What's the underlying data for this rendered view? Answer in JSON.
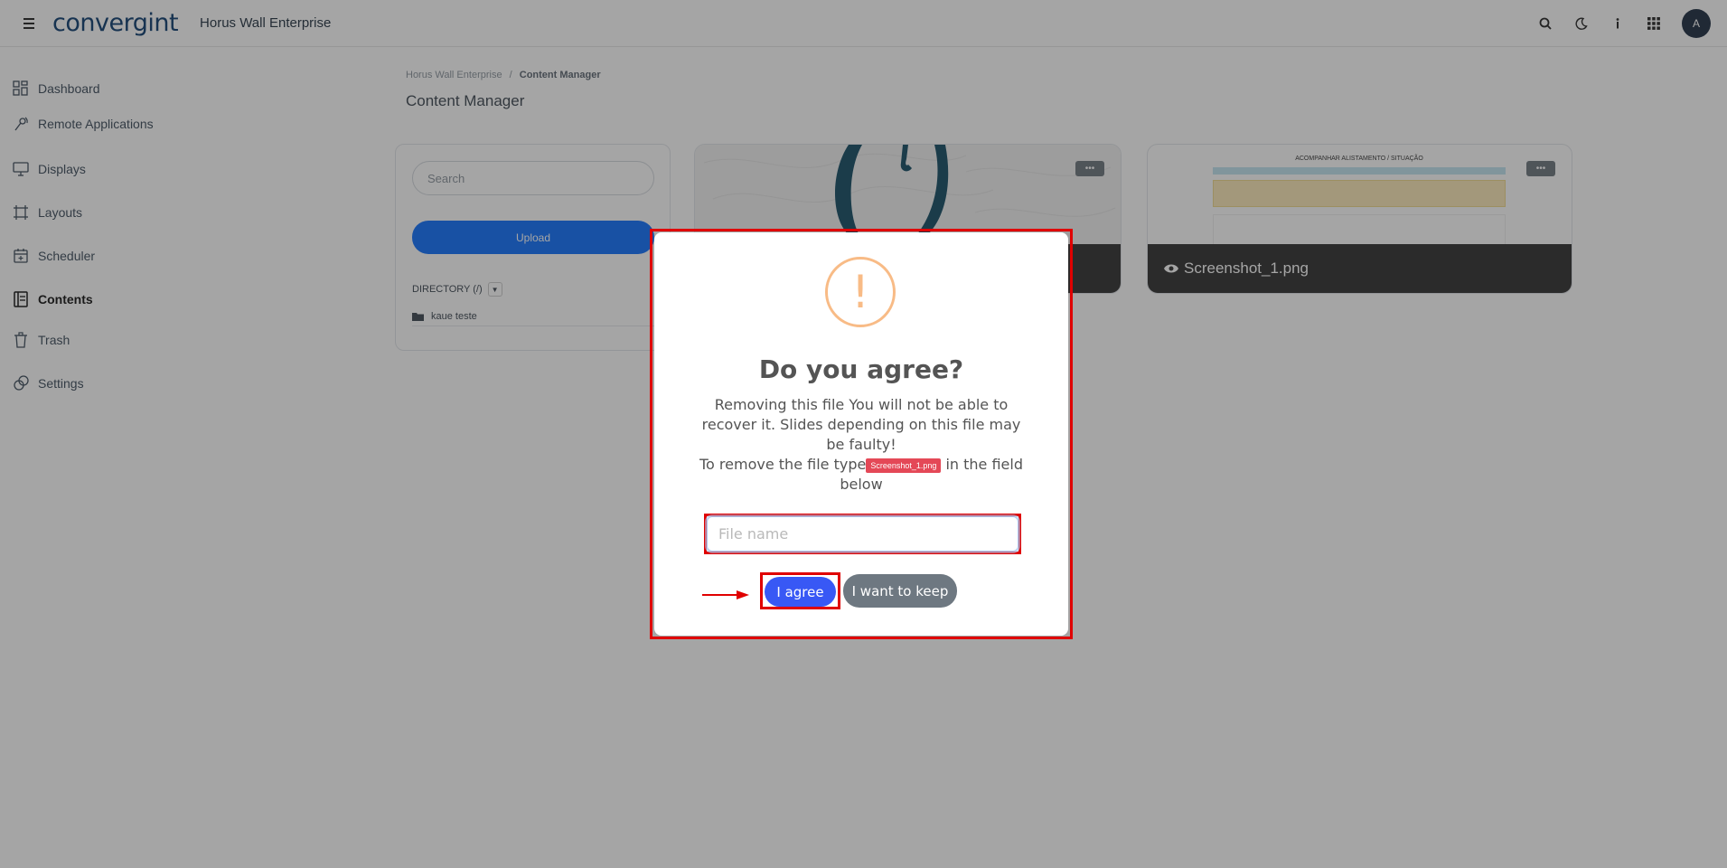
{
  "header": {
    "logo": "convergint",
    "app_title": "Horus Wall Enterprise",
    "avatar_initial": "A"
  },
  "sidebar": {
    "items": [
      {
        "label": "Dashboard",
        "icon": "dashboard-icon"
      },
      {
        "label": "Remote Applications",
        "icon": "remote-icon"
      },
      {
        "label": "Displays",
        "icon": "monitor-icon"
      },
      {
        "label": "Layouts",
        "icon": "layout-icon"
      },
      {
        "label": "Scheduler",
        "icon": "calendar-icon"
      },
      {
        "label": "Contents",
        "icon": "contents-icon"
      },
      {
        "label": "Trash",
        "icon": "trash-icon"
      },
      {
        "label": "Settings",
        "icon": "settings-icon"
      }
    ]
  },
  "breadcrumb": {
    "root": "Horus Wall Enterprise",
    "separator": "/",
    "current": "Content Manager"
  },
  "page_title": "Content Manager",
  "panel": {
    "search_placeholder": "Search",
    "upload_label": "Upload",
    "directory_label": "DIRECTORY (/)",
    "folder": "kaue teste"
  },
  "cards": [
    {
      "filename": ""
    },
    {
      "filename": "Screenshot_1.png",
      "thumb_heading": "ACOMPANHAR ALISTAMENTO / SITUAÇÃO"
    }
  ],
  "modal": {
    "title": "Do you agree?",
    "text_line1": "Removing this file You will not be able to recover it. Slides depending on this file may be faulty!",
    "text_prefix": "To remove the file type",
    "file_tag": "Screenshot_1.png",
    "text_suffix": " in the field below",
    "input_placeholder": "File name",
    "agree_label": "I agree",
    "keep_label": "I want to keep",
    "warning_color": "#f8bb86",
    "agree_color": "#3858f5",
    "highlight_color": "#e00000"
  }
}
